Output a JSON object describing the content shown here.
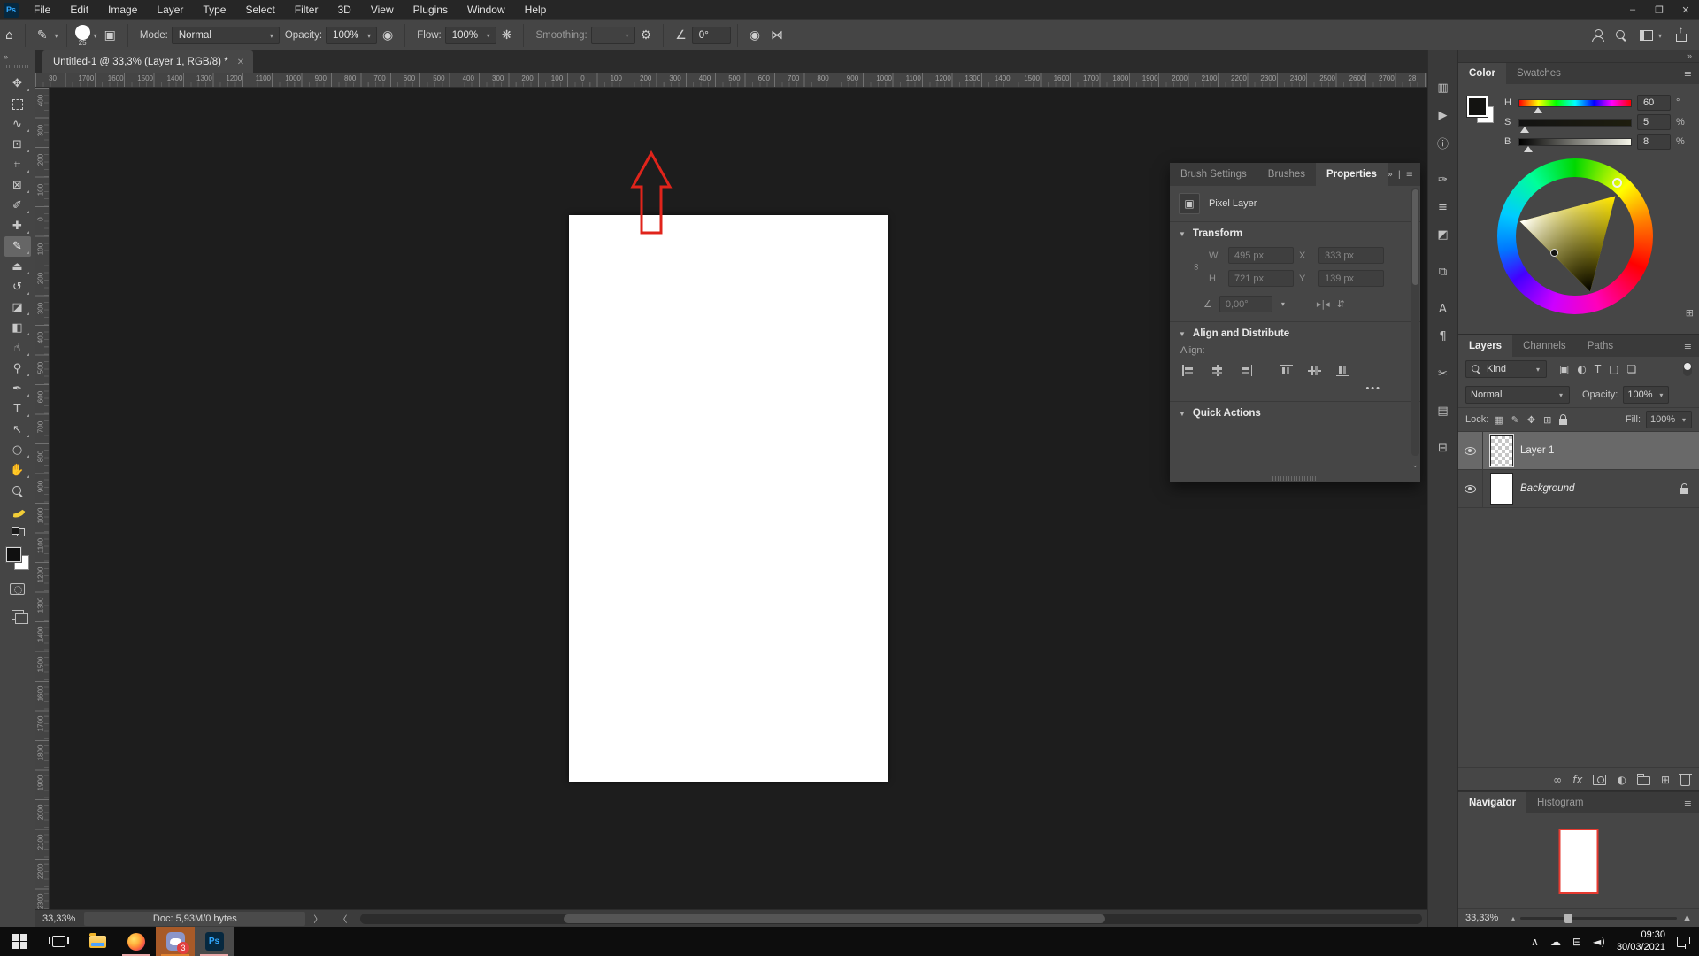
{
  "window": {
    "controls": {
      "minimize": "–",
      "restore": "❐",
      "close": "✕"
    }
  },
  "menubar": {
    "logo": "Ps",
    "items": [
      "File",
      "Edit",
      "Image",
      "Layer",
      "Type",
      "Select",
      "Filter",
      "3D",
      "View",
      "Plugins",
      "Window",
      "Help"
    ]
  },
  "options_bar": {
    "home_icon": "⌂",
    "brush_tool_icon": "✎",
    "brush_size": "25",
    "panel_toggle_icon": "▣",
    "mode_label": "Mode:",
    "mode_value": "Normal",
    "opacity_label": "Opacity:",
    "opacity_value": "100%",
    "pressure_icon": "◉",
    "flow_label": "Flow:",
    "flow_value": "100%",
    "airbrush_icon": "❋",
    "smoothing_label": "Smoothing:",
    "smoothing_value": "",
    "gear_icon": "⚙",
    "angle_icon": "∠",
    "angle_value": "0°",
    "size_pressure_icon": "◉",
    "symmetry_icon": "⋈"
  },
  "tabstrip": {
    "collapse": "»",
    "tab_title": "Untitled-1 @ 33,3% (Layer 1, RGB/8) *",
    "close": "✕"
  },
  "rulers": {
    "horizontal": [
      "30",
      "1700",
      "1600",
      "1500",
      "1400",
      "1300",
      "1200",
      "1100",
      "1000",
      "900",
      "800",
      "700",
      "600",
      "500",
      "400",
      "300",
      "200",
      "100",
      "0",
      "100",
      "200",
      "300",
      "400",
      "500",
      "600",
      "700",
      "800",
      "900",
      "1000",
      "1100",
      "1200",
      "1300",
      "1400",
      "1500",
      "1600",
      "1700",
      "1800",
      "1900",
      "2000",
      "2100",
      "2200",
      "2300",
      "2400",
      "2500",
      "2600",
      "2700",
      "28"
    ],
    "vertical": [
      "400",
      "300",
      "200",
      "100",
      "0",
      "100",
      "200",
      "300",
      "400",
      "500",
      "600",
      "700",
      "800",
      "900",
      "1000",
      "1100",
      "1200",
      "1300",
      "1400",
      "1500",
      "1600",
      "1700",
      "1800",
      "1900",
      "2000",
      "2100",
      "2200",
      "2300"
    ]
  },
  "toolbar": {
    "collapse": "»",
    "tools": [
      {
        "name": "move-tool",
        "glyph": "✥"
      },
      {
        "name": "marquee-tool",
        "kind": "marquee"
      },
      {
        "name": "lasso-tool",
        "glyph": "∿"
      },
      {
        "name": "object-selection-tool",
        "glyph": "⊡"
      },
      {
        "name": "crop-tool",
        "glyph": "⌗"
      },
      {
        "name": "frame-tool",
        "glyph": "⊠"
      },
      {
        "name": "eyedropper-tool",
        "glyph": "✐"
      },
      {
        "name": "healing-brush-tool",
        "glyph": "✚"
      },
      {
        "name": "brush-tool",
        "glyph": "✎",
        "selected": true
      },
      {
        "name": "clone-stamp-tool",
        "glyph": "⏏"
      },
      {
        "name": "history-brush-tool",
        "glyph": "↺"
      },
      {
        "name": "eraser-tool",
        "glyph": "◪"
      },
      {
        "name": "gradient-tool",
        "glyph": "◧"
      },
      {
        "name": "smudge-tool",
        "glyph": "☝"
      },
      {
        "name": "dodge-tool",
        "glyph": "⚲"
      },
      {
        "name": "pen-tool",
        "glyph": "✒"
      },
      {
        "name": "type-tool",
        "glyph": "T"
      },
      {
        "name": "path-selection-tool",
        "glyph": "↖"
      },
      {
        "name": "ellipse-tool",
        "glyph": "○"
      },
      {
        "name": "hand-tool",
        "glyph": "✋"
      },
      {
        "name": "zoom-tool",
        "kind": "zoom"
      },
      {
        "name": "banana-icon",
        "kind": "banana"
      },
      {
        "name": "default-colors-icon",
        "kind": "minicolors"
      },
      {
        "name": "foreground-background-swatch",
        "kind": "fgbg"
      },
      {
        "name": "quick-mask-button",
        "kind": "quickmask"
      },
      {
        "name": "screen-mode-button",
        "kind": "screenmode"
      }
    ]
  },
  "dock_icons": [
    {
      "name": "histogram-panel-icon",
      "glyph": "▥"
    },
    {
      "name": "actions-panel-icon",
      "glyph": "▶"
    },
    {
      "name": "info-panel-icon",
      "glyph": "ⓘ"
    },
    {
      "name": "brush-settings-panel-icon",
      "glyph": "✑",
      "gap": true
    },
    {
      "name": "tool-presets-panel-icon",
      "glyph": "≡"
    },
    {
      "name": "adjustments-panel-icon",
      "glyph": "◩"
    },
    {
      "name": "clone-source-panel-icon",
      "glyph": "⧉",
      "gap": true
    },
    {
      "name": "character-panel-icon",
      "glyph": "A",
      "gap": true
    },
    {
      "name": "paragraph-panel-icon",
      "glyph": "¶"
    },
    {
      "name": "glyphs-panel-icon",
      "glyph": "✂",
      "gap": true
    },
    {
      "name": "libraries-panel-icon",
      "glyph": "▤",
      "gap": true
    },
    {
      "name": "layer-comps-panel-icon",
      "glyph": "⊟",
      "gap": true
    }
  ],
  "properties_panel": {
    "tabs": [
      {
        "label": "Brush Settings",
        "active": false
      },
      {
        "label": "Brushes",
        "active": false
      },
      {
        "label": "Properties",
        "active": true
      }
    ],
    "overflow": "»",
    "menu": "≡",
    "layer_type": "Pixel Layer",
    "transform": {
      "title": "Transform",
      "w_label": "W",
      "w_value": "495 px",
      "x_label": "X",
      "x_value": "333 px",
      "h_label": "H",
      "h_value": "721 px",
      "y_label": "Y",
      "y_value": "139 px",
      "angle_value": "0,00°",
      "flip_h_icon": "▸|◂",
      "flip_v_icon": "⇵"
    },
    "align": {
      "title": "Align and Distribute",
      "align_label": "Align:",
      "more": "•••",
      "icons": [
        "align-left",
        "align-hcenter",
        "align-right",
        "align-top",
        "align-vcenter",
        "align-bottom"
      ]
    },
    "quick_actions": {
      "title": "Quick Actions"
    }
  },
  "color_panel": {
    "collapse": "»",
    "tabs": [
      {
        "label": "Color",
        "active": true
      },
      {
        "label": "Swatches",
        "active": false
      }
    ],
    "menu": "≡",
    "sliders": [
      {
        "label": "H",
        "value": "60",
        "unit": "°",
        "pos": 17,
        "cls": "h"
      },
      {
        "label": "S",
        "value": "5",
        "unit": "%",
        "pos": 5,
        "cls": "s"
      },
      {
        "label": "B",
        "value": "8",
        "unit": "%",
        "pos": 8,
        "cls": "b"
      }
    ],
    "expand_icon": "⊞"
  },
  "layers_panel": {
    "tabs": [
      {
        "label": "Layers",
        "active": true
      },
      {
        "label": "Channels",
        "active": false
      },
      {
        "label": "Paths",
        "active": false
      }
    ],
    "menu": "≡",
    "filter_label": "Kind",
    "filter_icons": [
      {
        "name": "filter-pixel-icon",
        "glyph": "▣"
      },
      {
        "name": "filter-adjustment-icon",
        "glyph": "◐"
      },
      {
        "name": "filter-type-icon",
        "glyph": "T"
      },
      {
        "name": "filter-shape-icon",
        "glyph": "▢"
      },
      {
        "name": "filter-smart-icon",
        "glyph": "❏"
      }
    ],
    "blend_mode": "Normal",
    "opacity_label": "Opacity:",
    "opacity_value": "100%",
    "lock_label": "Lock:",
    "lock_icons": [
      {
        "name": "lock-transparency-icon",
        "glyph": "▦"
      },
      {
        "name": "lock-pixels-icon",
        "glyph": "✎"
      },
      {
        "name": "lock-position-icon",
        "glyph": "✥"
      },
      {
        "name": "lock-artboard-icon",
        "glyph": "⊞"
      },
      {
        "name": "lock-all-icon",
        "kind": "lock"
      }
    ],
    "fill_label": "Fill:",
    "fill_value": "100%",
    "layers": [
      {
        "name": "Layer 1",
        "selected": true,
        "thumb": "checker",
        "italic": false,
        "locked": false
      },
      {
        "name": "Background",
        "selected": false,
        "thumb": "white",
        "italic": true,
        "locked": true
      }
    ],
    "bottom_icons": [
      {
        "name": "link-layers-icon",
        "glyph": "∞"
      },
      {
        "name": "layer-effects-icon",
        "glyph": "fx",
        "cls": "fx"
      },
      {
        "name": "layer-mask-icon",
        "kind": "mask"
      },
      {
        "name": "adjustment-layer-icon",
        "glyph": "◐"
      },
      {
        "name": "new-group-icon",
        "kind": "folder"
      },
      {
        "name": "new-layer-icon",
        "glyph": "⊞"
      },
      {
        "name": "delete-layer-icon",
        "kind": "trash"
      }
    ]
  },
  "navigator_panel": {
    "tabs": [
      {
        "label": "Navigator",
        "active": true
      },
      {
        "label": "Histogram",
        "active": false
      }
    ],
    "menu": "≡",
    "zoom": "33,33%",
    "zoom_out_icon": "▴",
    "zoom_in_icon": "▲"
  },
  "status_bar": {
    "zoom": "33,33%",
    "doc": "Doc: 5,93M/0 bytes",
    "next": "〉",
    "prev": "〈"
  },
  "taskbar": {
    "discord_badge": "3",
    "clock_time": "09:30",
    "clock_date": "30/03/2021",
    "tray_icons": [
      {
        "name": "hidden-icons-icon",
        "glyph": "∧"
      },
      {
        "name": "onedrive-icon",
        "glyph": "☁"
      },
      {
        "name": "network-icon",
        "glyph": "⊟"
      },
      {
        "name": "volume-icon",
        "glyph": "◄)"
      }
    ]
  },
  "colors": {
    "accent_red": "#e0241b",
    "underline": "#e8a7a7",
    "discord_tile": "#a85a28",
    "ps_blue": "#31a8ff"
  }
}
